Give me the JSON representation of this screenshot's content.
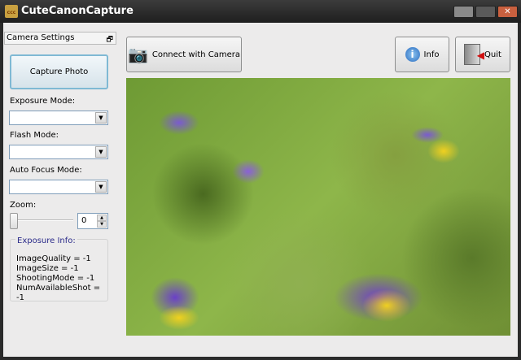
{
  "window": {
    "title": "CuteCanonCapture",
    "icon_text": "ccc"
  },
  "dock": {
    "title": "Camera Settings"
  },
  "capture_button": "Capture Photo",
  "exposure_mode": {
    "label": "Exposure Mode:",
    "value": ""
  },
  "flash_mode": {
    "label": "Flash Mode:",
    "value": ""
  },
  "af_mode": {
    "label": "Auto Focus Mode:",
    "value": ""
  },
  "zoom": {
    "label": "Zoom:",
    "value": "0",
    "slider_value": 0
  },
  "exposure_info": {
    "title": "Exposure Info:",
    "lines": [
      "ImageQuality = -1",
      "ImageSize = -1",
      "ShootingMode = -1",
      "NumAvailableShot = -1"
    ]
  },
  "toolbar": {
    "connect": "Connect with Camera",
    "info": "Info",
    "quit": "Quit"
  }
}
